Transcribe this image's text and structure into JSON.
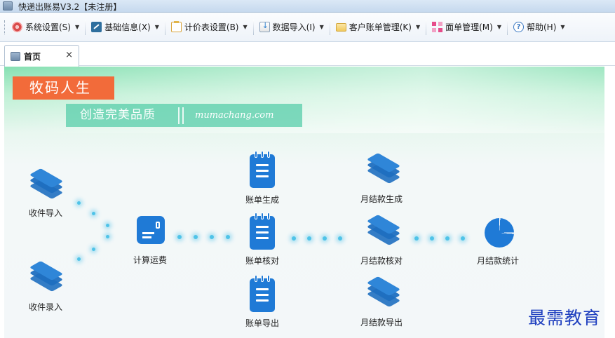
{
  "window": {
    "title": "快递出账易V3.2【未注册】"
  },
  "menubar": {
    "items": [
      {
        "label": "系统设置(S)",
        "icon": "system-settings-icon"
      },
      {
        "label": "基础信息(X)",
        "icon": "basic-info-icon"
      },
      {
        "label": "计价表设置(B)",
        "icon": "price-table-icon"
      },
      {
        "label": "数据导入(I)",
        "icon": "data-import-icon"
      },
      {
        "label": "客户账单管理(K)",
        "icon": "folder-icon"
      },
      {
        "label": "面单管理(M)",
        "icon": "waybill-icon"
      },
      {
        "label": "帮助(H)",
        "icon": "help-icon"
      }
    ]
  },
  "tabs": [
    {
      "label": "首页",
      "close": "×"
    }
  ],
  "banner": {
    "brand": "牧码人生",
    "slogan": "创造完美品质",
    "domain": "mumachang.com"
  },
  "flow": {
    "nodes": {
      "receive_import": "收件导入",
      "receive_entry": "收件录入",
      "calc_freight": "计算运费",
      "bill_generate": "账单生成",
      "bill_check": "账单核对",
      "bill_export": "账单导出",
      "monthly_generate": "月结款生成",
      "monthly_check": "月结款核对",
      "monthly_export": "月结款导出",
      "monthly_stats": "月结款统计"
    }
  },
  "watermark": "最需教育",
  "colors": {
    "accent_blue": "#1f7ad6",
    "brand_orange": "#f26b3a",
    "slogan_green": "#57cdaa"
  }
}
